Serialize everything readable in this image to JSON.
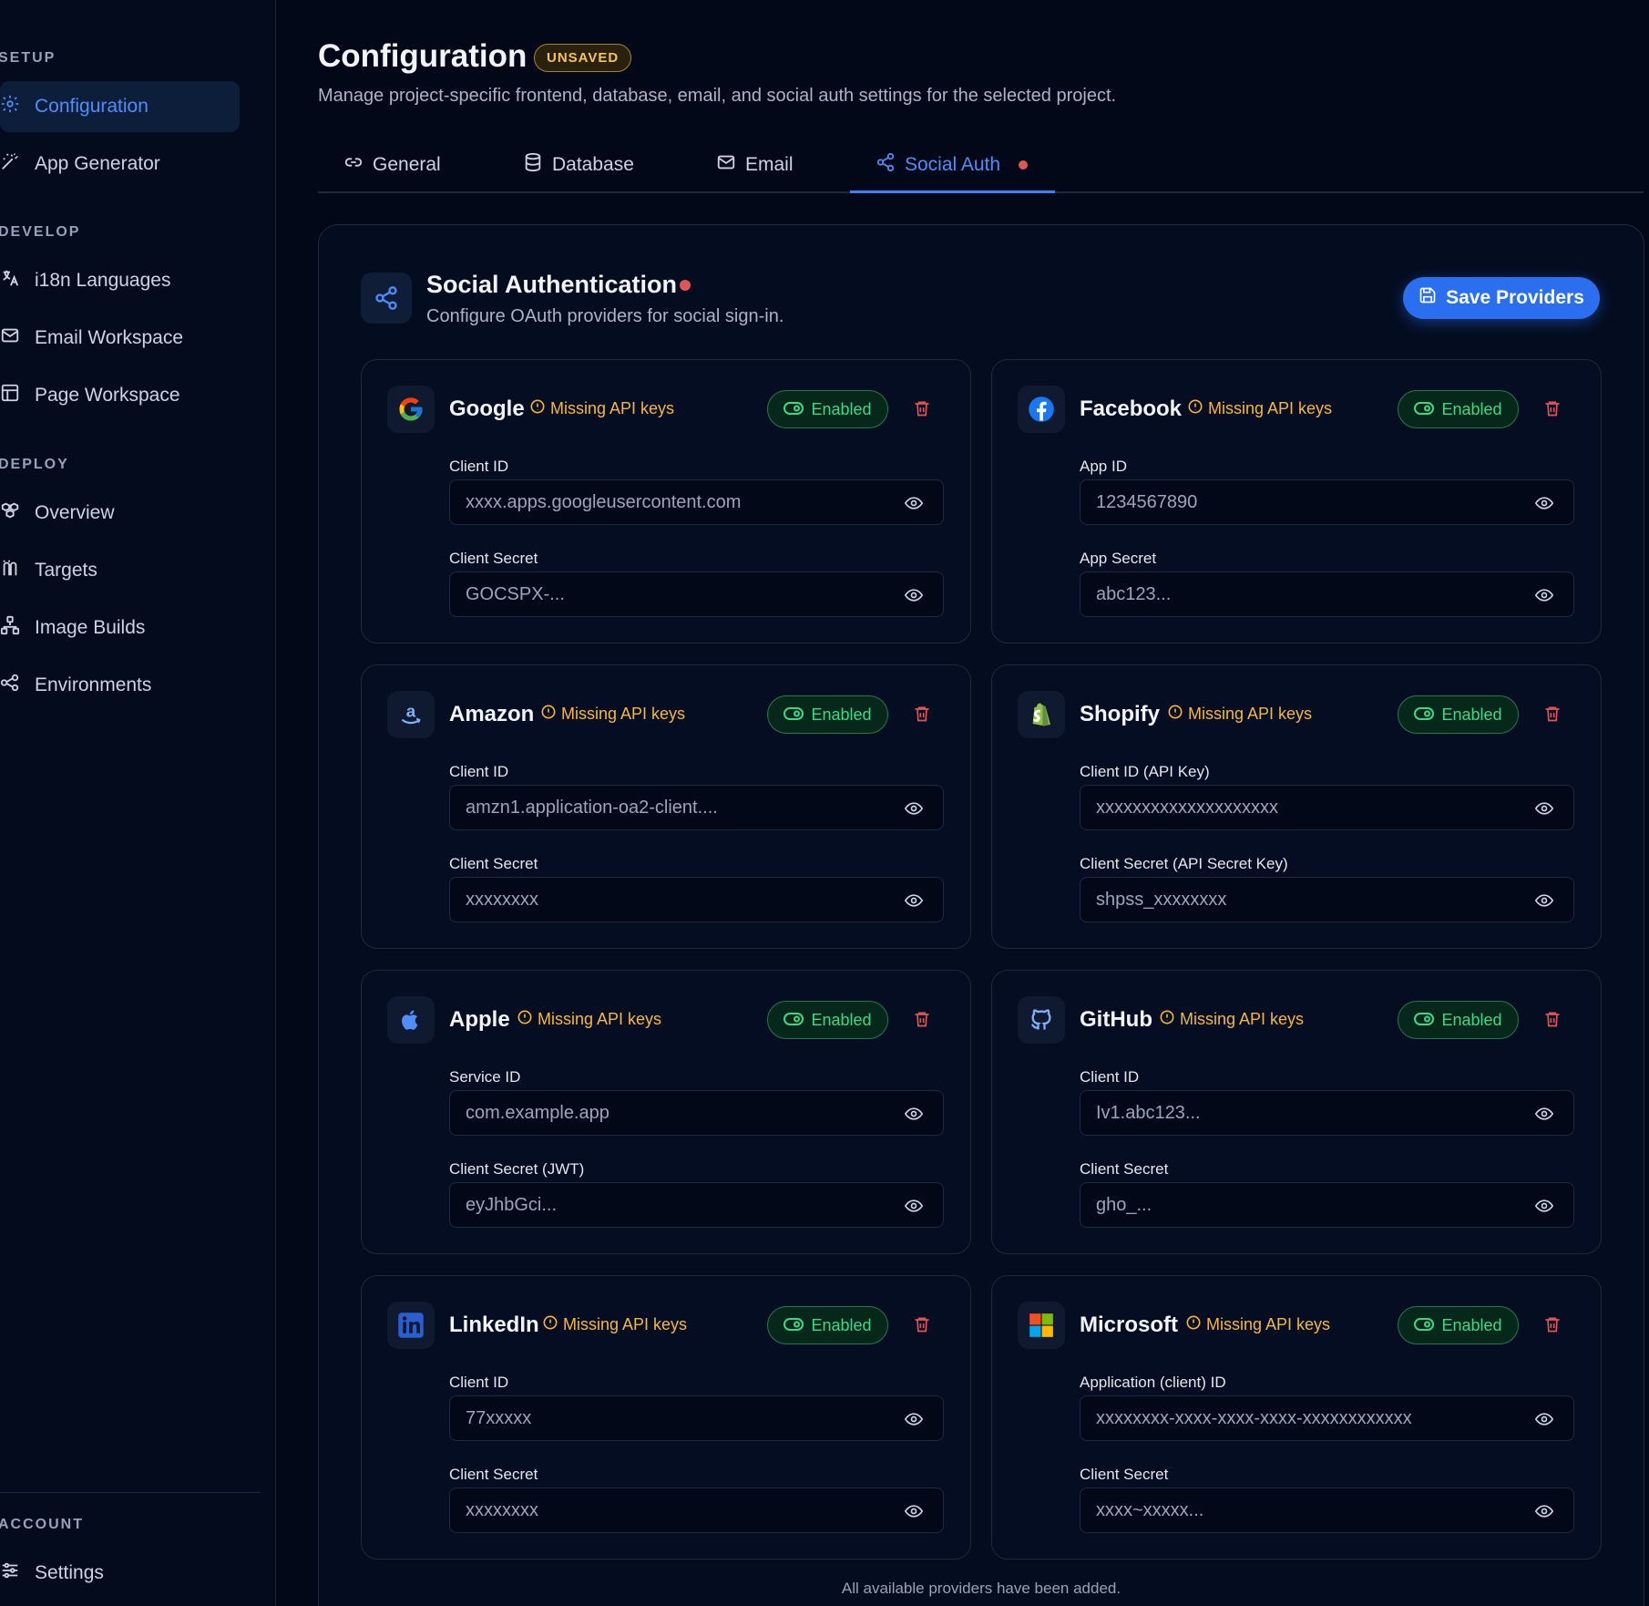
{
  "sidebar": {
    "sections": [
      {
        "label": "SETUP",
        "items": [
          {
            "label": "Configuration",
            "icon": "gear-icon",
            "active": true
          },
          {
            "label": "App Generator",
            "icon": "magic-wand-icon",
            "active": false
          }
        ]
      },
      {
        "label": "DEVELOP",
        "items": [
          {
            "label": "i18n Languages",
            "icon": "translate-icon",
            "active": false
          },
          {
            "label": "Email Workspace",
            "icon": "mail-icon",
            "active": false
          },
          {
            "label": "Page Workspace",
            "icon": "layout-icon",
            "active": false
          }
        ]
      },
      {
        "label": "DEPLOY",
        "items": [
          {
            "label": "Overview",
            "icon": "boxes-icon",
            "active": false
          },
          {
            "label": "Targets",
            "icon": "targets-icon",
            "active": false
          },
          {
            "label": "Image Builds",
            "icon": "network-icon",
            "active": false
          },
          {
            "label": "Environments",
            "icon": "nodes-icon",
            "active": false
          }
        ]
      },
      {
        "label": "ACCOUNT",
        "items": [
          {
            "label": "Settings",
            "icon": "sliders-icon",
            "active": false
          }
        ]
      }
    ]
  },
  "header": {
    "title": "Configuration",
    "badge": "UNSAVED",
    "description": "Manage project-specific frontend, database, email, and social auth settings for the selected project."
  },
  "tabs": [
    {
      "label": "General",
      "icon": "link-icon",
      "active": false
    },
    {
      "label": "Database",
      "icon": "database-icon",
      "active": false
    },
    {
      "label": "Email",
      "icon": "mail-icon",
      "active": false
    },
    {
      "label": "Social Auth",
      "icon": "share-icon",
      "active": true,
      "dot": true
    }
  ],
  "panel": {
    "title": "Social Authentication",
    "subtitle": "Configure OAuth providers for social sign-in.",
    "save_label": "Save Providers"
  },
  "providers": [
    {
      "name": "Google",
      "icon": "google-icon",
      "warning": "Missing API keys",
      "status": "Enabled",
      "fields": [
        {
          "label": "Client ID",
          "value": "xxxx.apps.googleusercontent.com"
        },
        {
          "label": "Client Secret",
          "value": "GOCSPX-..."
        }
      ]
    },
    {
      "name": "Facebook",
      "icon": "facebook-icon",
      "warning": "Missing API keys",
      "status": "Enabled",
      "fields": [
        {
          "label": "App ID",
          "value": "1234567890"
        },
        {
          "label": "App Secret",
          "value": "abc123..."
        }
      ]
    },
    {
      "name": "Amazon",
      "icon": "amazon-icon",
      "warning": "Missing API keys",
      "status": "Enabled",
      "fields": [
        {
          "label": "Client ID",
          "value": "amzn1.application-oa2-client...."
        },
        {
          "label": "Client Secret",
          "value": "xxxxxxxx"
        }
      ]
    },
    {
      "name": "Shopify",
      "icon": "shopify-icon",
      "warning": "Missing API keys",
      "status": "Enabled",
      "fields": [
        {
          "label": "Client ID (API Key)",
          "value": "xxxxxxxxxxxxxxxxxxxx"
        },
        {
          "label": "Client Secret (API Secret Key)",
          "value": "shpss_xxxxxxxx"
        }
      ]
    },
    {
      "name": "Apple",
      "icon": "apple-icon",
      "warning": "Missing API keys",
      "status": "Enabled",
      "fields": [
        {
          "label": "Service ID",
          "value": "com.example.app"
        },
        {
          "label": "Client Secret (JWT)",
          "value": "eyJhbGci..."
        }
      ]
    },
    {
      "name": "GitHub",
      "icon": "github-icon",
      "warning": "Missing API keys",
      "status": "Enabled",
      "fields": [
        {
          "label": "Client ID",
          "value": "Iv1.abc123..."
        },
        {
          "label": "Client Secret",
          "value": "gho_..."
        }
      ]
    },
    {
      "name": "LinkedIn",
      "icon": "linkedin-icon",
      "warning": "Missing API keys",
      "status": "Enabled",
      "fields": [
        {
          "label": "Client ID",
          "value": "77xxxxx"
        },
        {
          "label": "Client Secret",
          "value": "xxxxxxxx"
        }
      ]
    },
    {
      "name": "Microsoft",
      "icon": "microsoft-icon",
      "warning": "Missing API keys",
      "status": "Enabled",
      "fields": [
        {
          "label": "Application (client) ID",
          "value": "xxxxxxxx-xxxx-xxxx-xxxx-xxxxxxxxxxxx"
        },
        {
          "label": "Client Secret",
          "value": "xxxx~xxxxx..."
        }
      ]
    }
  ],
  "footer_note": "All available providers have been added.",
  "colors": {
    "accent": "#3b82f6",
    "warning": "#f5b83d",
    "success": "#3fd68a",
    "danger": "#e05656",
    "background": "#020817"
  }
}
